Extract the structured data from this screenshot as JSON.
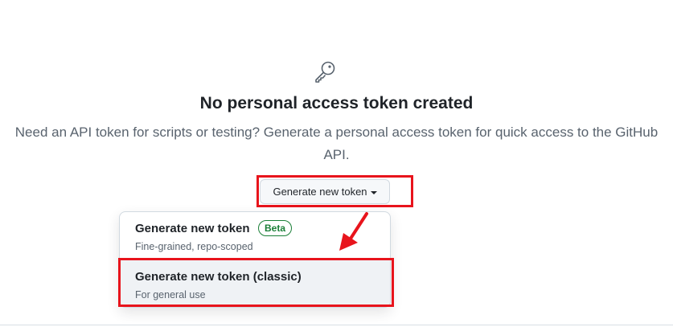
{
  "empty_state": {
    "icon": "key-icon",
    "title": "No personal access token created",
    "description": "Need an API token for scripts or testing? Generate a personal access token for quick access to the GitHub API."
  },
  "generate_button": {
    "label": "Generate new token",
    "icon": "caret-down-icon"
  },
  "menu": {
    "items": [
      {
        "title": "Generate new token",
        "badge": "Beta",
        "subtitle": "Fine-grained, repo-scoped"
      },
      {
        "title": "Generate new token (classic)",
        "subtitle": "For general use"
      }
    ]
  },
  "annotations": {
    "highlight_color": "#e8141c",
    "arrow": "arrow-icon"
  },
  "colors": {
    "text_primary": "#1f2328",
    "text_muted": "#59636e",
    "beta_green": "#1a7f37",
    "hover_bg": "#eff2f5"
  }
}
